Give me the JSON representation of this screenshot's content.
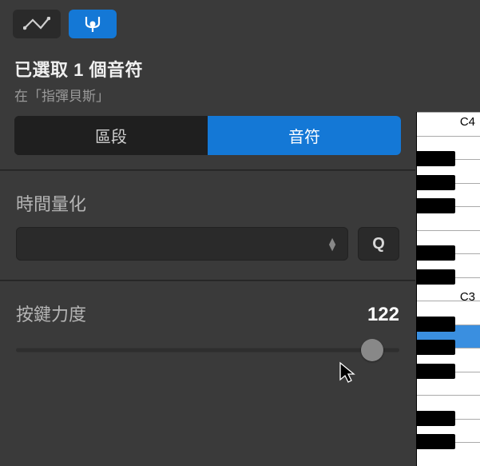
{
  "header": {
    "title": "已選取 1 個音符",
    "subtitle": "在「指彈貝斯」"
  },
  "tabs": {
    "region": "區段",
    "note": "音符"
  },
  "quantize": {
    "label": "時間量化",
    "button": "Q"
  },
  "velocity": {
    "label": "按鍵力度",
    "value": "122"
  },
  "keys": {
    "c4": "C4",
    "c3": "C3"
  }
}
